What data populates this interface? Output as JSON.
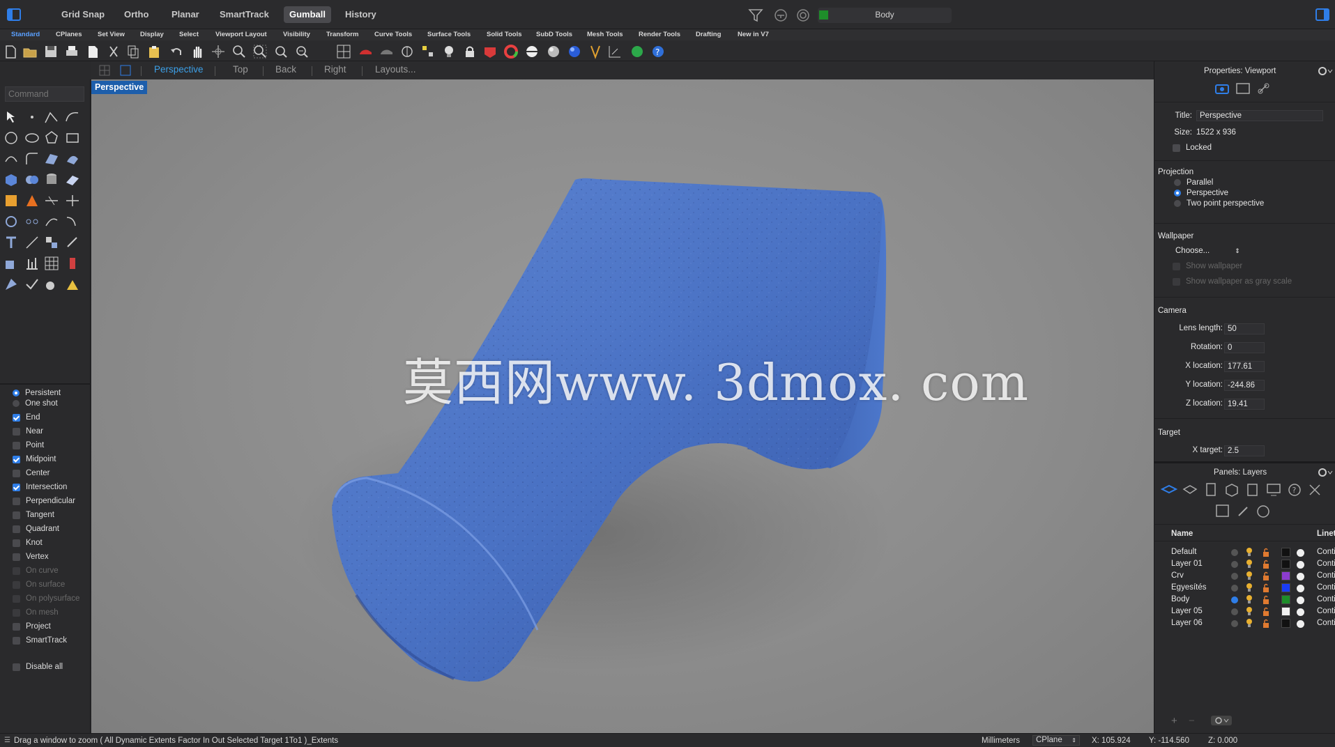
{
  "topbar": {
    "buttons": [
      "Grid Snap",
      "Ortho",
      "Planar",
      "SmartTrack",
      "Gumball",
      "History"
    ],
    "active": "Gumball",
    "current_layer": "Body"
  },
  "toolbar_tabs": [
    "Standard",
    "CPlanes",
    "Set View",
    "Display",
    "Select",
    "Viewport Layout",
    "Visibility",
    "Transform",
    "Curve Tools",
    "Surface Tools",
    "Solid Tools",
    "SubD Tools",
    "Mesh Tools",
    "Render Tools",
    "Drafting",
    "New in V7"
  ],
  "view_tabs": [
    "Perspective",
    "Top",
    "Back",
    "Right",
    "Layouts..."
  ],
  "command": {
    "placeholder": "Command"
  },
  "viewport": {
    "label": "Perspective",
    "watermark": "莫西网www. 3dmox. com"
  },
  "osnap": {
    "modes": [
      {
        "label": "Persistent",
        "type": "radio",
        "on": true
      },
      {
        "label": "One shot",
        "type": "radio",
        "on": false
      }
    ],
    "items": [
      {
        "label": "End",
        "on": true
      },
      {
        "label": "Near",
        "on": false
      },
      {
        "label": "Point",
        "on": false
      },
      {
        "label": "Midpoint",
        "on": true
      },
      {
        "label": "Center",
        "on": false
      },
      {
        "label": "Intersection",
        "on": true
      },
      {
        "label": "Perpendicular",
        "on": false
      },
      {
        "label": "Tangent",
        "on": false
      },
      {
        "label": "Quadrant",
        "on": false
      },
      {
        "label": "Knot",
        "on": false
      },
      {
        "label": "Vertex",
        "on": false
      },
      {
        "label": "On curve",
        "on": false,
        "dim": true
      },
      {
        "label": "On surface",
        "on": false,
        "dim": true
      },
      {
        "label": "On polysurface",
        "on": false,
        "dim": true
      },
      {
        "label": "On mesh",
        "on": false,
        "dim": true
      },
      {
        "label": "Project",
        "on": false
      },
      {
        "label": "SmartTrack",
        "on": false
      }
    ],
    "disable_all": "Disable all"
  },
  "properties": {
    "header": "Properties: Viewport",
    "title_label": "Title:",
    "title_value": "Perspective",
    "size_label": "Size:",
    "size_value": "1522 x 936",
    "locked": "Locked",
    "projection_header": "Projection",
    "projection_options": [
      {
        "label": "Parallel",
        "on": false
      },
      {
        "label": "Perspective",
        "on": true
      },
      {
        "label": "Two point perspective",
        "on": false
      }
    ],
    "wallpaper_header": "Wallpaper",
    "wallpaper_choose": "Choose...",
    "show_wallpaper": "Show wallpaper",
    "show_wallpaper_gray": "Show wallpaper as gray scale",
    "camera_header": "Camera",
    "camera_fields": [
      {
        "label": "Lens length:",
        "value": "50"
      },
      {
        "label": "Rotation:",
        "value": "0"
      },
      {
        "label": "X location:",
        "value": "177.61"
      },
      {
        "label": "Y location:",
        "value": "-244.86"
      },
      {
        "label": "Z location:",
        "value": "19.41"
      }
    ],
    "target_header": "Target",
    "target_fields": [
      {
        "label": "X target:",
        "value": "2.5"
      }
    ]
  },
  "layers": {
    "header": "Panels: Layers",
    "col_name": "Name",
    "col_linetype": "Linet",
    "rows": [
      {
        "name": "Default",
        "color": "#111111",
        "current": false,
        "linetype": "Conti"
      },
      {
        "name": "Layer 01",
        "color": "#111111",
        "current": false,
        "linetype": "Conti"
      },
      {
        "name": "Crv",
        "color": "#8b3ccf",
        "current": false,
        "linetype": "Conti"
      },
      {
        "name": "Egyesítés",
        "color": "#1a3cf5",
        "current": false,
        "linetype": "Conti"
      },
      {
        "name": "Body",
        "color": "#1e8e2a",
        "current": true,
        "linetype": "Conti"
      },
      {
        "name": "Layer 05",
        "color": "#f2f2f2",
        "current": false,
        "linetype": "Conti"
      },
      {
        "name": "Layer 06",
        "color": "#111111",
        "current": false,
        "linetype": "Conti"
      }
    ]
  },
  "status": {
    "prompt": "Drag a window to zoom ( All Dynamic Extents Factor In Out Selected Target 1To1 )_Extents",
    "units": "Millimeters",
    "cplane": "CPlane",
    "x": "X: 105.924",
    "y": "Y: -114.560",
    "z": "Z: 0.000"
  },
  "colors": {
    "accent": "#2f7ee8",
    "viewport_label_bg": "#1d5eab",
    "model": "#4a72c4"
  }
}
